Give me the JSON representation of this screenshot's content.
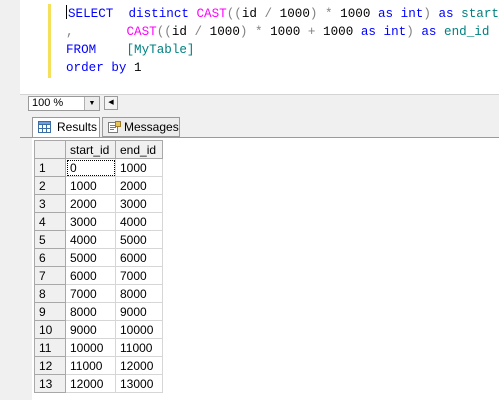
{
  "editor": {
    "lines": [
      [
        {
          "t": "SELECT  ",
          "c": "kw"
        },
        {
          "t": "distinct ",
          "c": "kw"
        },
        {
          "t": "CAST",
          "c": "fn"
        },
        {
          "t": "((",
          "c": "op"
        },
        {
          "t": "id ",
          "c": "nm"
        },
        {
          "t": "/ ",
          "c": "op"
        },
        {
          "t": "1000",
          "c": "nm"
        },
        {
          "t": ") ",
          "c": "op"
        },
        {
          "t": "* ",
          "c": "op"
        },
        {
          "t": "1000 ",
          "c": "nm"
        },
        {
          "t": "as ",
          "c": "kw"
        },
        {
          "t": "int",
          "c": "kw"
        },
        {
          "t": ") ",
          "c": "op"
        },
        {
          "t": "as ",
          "c": "kw"
        },
        {
          "t": "start_id",
          "c": "st"
        }
      ],
      [
        {
          "t": ",       ",
          "c": "op"
        },
        {
          "t": "CAST",
          "c": "fn"
        },
        {
          "t": "((",
          "c": "op"
        },
        {
          "t": "id ",
          "c": "nm"
        },
        {
          "t": "/ ",
          "c": "op"
        },
        {
          "t": "1000",
          "c": "nm"
        },
        {
          "t": ") ",
          "c": "op"
        },
        {
          "t": "* ",
          "c": "op"
        },
        {
          "t": "1000 ",
          "c": "nm"
        },
        {
          "t": "+ ",
          "c": "op"
        },
        {
          "t": "1000 ",
          "c": "nm"
        },
        {
          "t": "as ",
          "c": "kw"
        },
        {
          "t": "int",
          "c": "kw"
        },
        {
          "t": ") ",
          "c": "op"
        },
        {
          "t": "as ",
          "c": "kw"
        },
        {
          "t": "end_id",
          "c": "st"
        }
      ],
      [
        {
          "t": "FROM    ",
          "c": "kw"
        },
        {
          "t": "[MyTable]",
          "c": "st"
        }
      ],
      [
        {
          "t": "order ",
          "c": "kw"
        },
        {
          "t": "by ",
          "c": "kw"
        },
        {
          "t": "1",
          "c": "nm"
        }
      ]
    ]
  },
  "zoom": {
    "value": "100 %"
  },
  "tabs": {
    "results_label": "Results",
    "messages_label": "Messages"
  },
  "grid": {
    "columns": [
      "start_id",
      "end_id"
    ],
    "rows": [
      {
        "n": "1",
        "start_id": "0",
        "end_id": "1000"
      },
      {
        "n": "2",
        "start_id": "1000",
        "end_id": "2000"
      },
      {
        "n": "3",
        "start_id": "2000",
        "end_id": "3000"
      },
      {
        "n": "4",
        "start_id": "3000",
        "end_id": "4000"
      },
      {
        "n": "5",
        "start_id": "4000",
        "end_id": "5000"
      },
      {
        "n": "6",
        "start_id": "5000",
        "end_id": "6000"
      },
      {
        "n": "7",
        "start_id": "6000",
        "end_id": "7000"
      },
      {
        "n": "8",
        "start_id": "7000",
        "end_id": "8000"
      },
      {
        "n": "9",
        "start_id": "8000",
        "end_id": "9000"
      },
      {
        "n": "10",
        "start_id": "9000",
        "end_id": "10000"
      },
      {
        "n": "11",
        "start_id": "10000",
        "end_id": "11000"
      },
      {
        "n": "12",
        "start_id": "11000",
        "end_id": "12000"
      },
      {
        "n": "13",
        "start_id": "12000",
        "end_id": "13000"
      }
    ]
  }
}
